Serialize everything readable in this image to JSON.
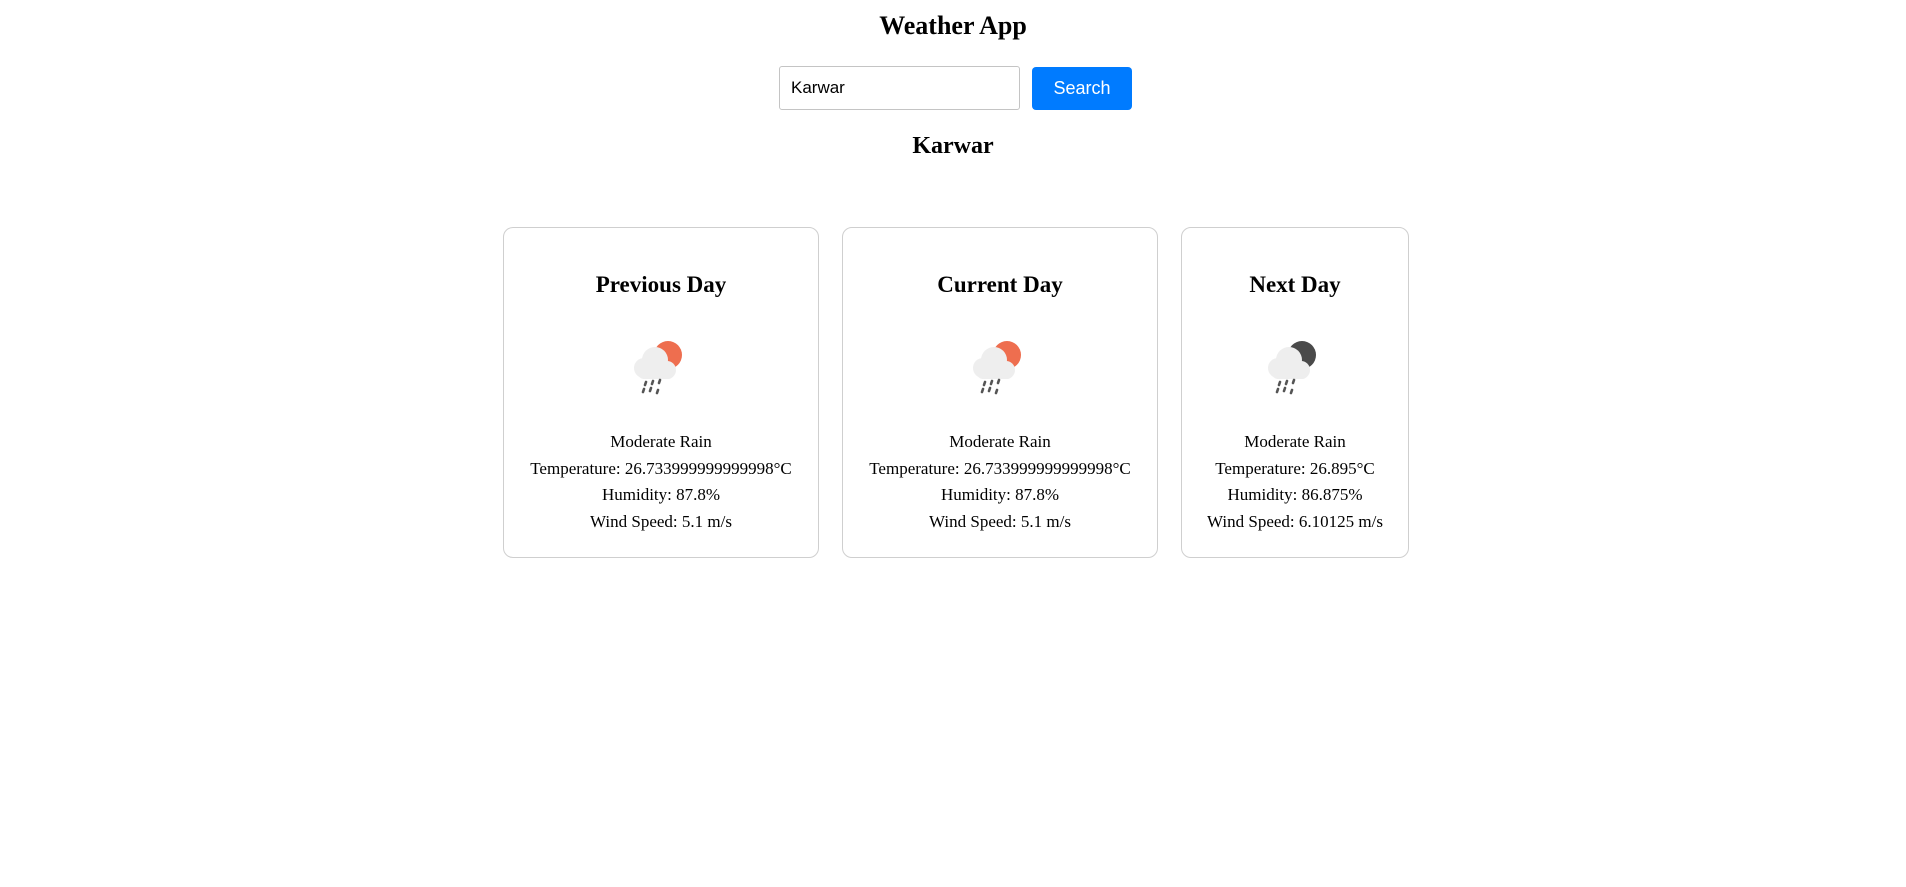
{
  "app": {
    "title": "Weather App"
  },
  "search": {
    "value": "Karwar",
    "button_label": "Search"
  },
  "location": {
    "name": "Karwar"
  },
  "forecast": [
    {
      "title": "Previous Day",
      "icon": "rain-cloud-sun-icon",
      "condition": "Moderate Rain",
      "temperature": "Temperature: 26.733999999999998°C",
      "humidity": "Humidity: 87.8%",
      "wind": "Wind Speed: 5.1 m/s"
    },
    {
      "title": "Current Day",
      "icon": "rain-cloud-sun-icon",
      "condition": "Moderate Rain",
      "temperature": "Temperature: 26.733999999999998°C",
      "humidity": "Humidity: 87.8%",
      "wind": "Wind Speed: 5.1 m/s"
    },
    {
      "title": "Next Day",
      "icon": "rain-cloud-moon-icon",
      "condition": "Moderate Rain",
      "temperature": "Temperature: 26.895°C",
      "humidity": "Humidity: 86.875%",
      "wind": "Wind Speed: 6.10125 m/s"
    }
  ],
  "colors": {
    "accent": "#007bff",
    "sun": "#ee6e4f",
    "moon": "#4a4a4a",
    "cloud": "#eeeeee",
    "rain": "#555555",
    "card_border": "#cfcfcf"
  }
}
